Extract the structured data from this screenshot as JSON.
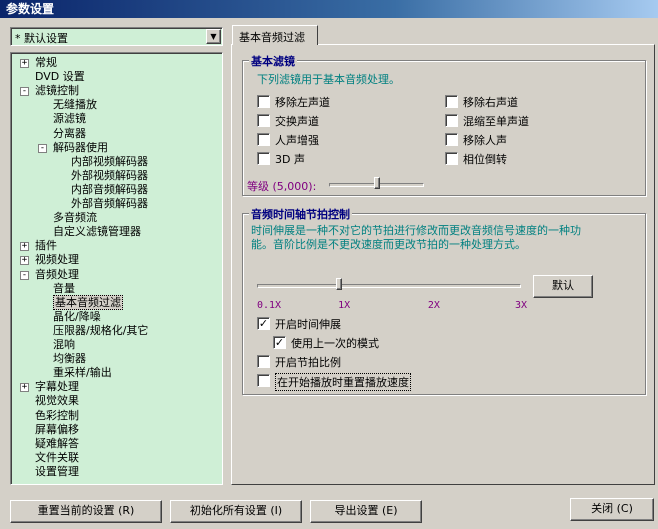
{
  "window": {
    "title": "参数设置"
  },
  "preset": {
    "value": "* 默认设置"
  },
  "tree": [
    {
      "label": "常规",
      "expander": "+"
    },
    {
      "label": "DVD 设置",
      "expander": ""
    },
    {
      "label": "滤镜控制",
      "expander": "−"
    },
    {
      "label": "无缝播放",
      "expander": ""
    },
    {
      "label": "源滤镜",
      "expander": ""
    },
    {
      "label": "分离器",
      "expander": ""
    },
    {
      "label": "解码器使用",
      "expander": "−"
    },
    {
      "label": "内部视频解码器",
      "expander": ""
    },
    {
      "label": "外部视频解码器",
      "expander": ""
    },
    {
      "label": "内部音频解码器",
      "expander": ""
    },
    {
      "label": "外部音频解码器",
      "expander": ""
    },
    {
      "label": "多音频流",
      "expander": ""
    },
    {
      "label": "自定义滤镜管理器",
      "expander": ""
    },
    {
      "label": "插件",
      "expander": "+"
    },
    {
      "label": "视频处理",
      "expander": "+"
    },
    {
      "label": "音频处理",
      "expander": "−"
    },
    {
      "label": "音量",
      "expander": ""
    },
    {
      "label": "基本音频过滤",
      "expander": ""
    },
    {
      "label": "晶化/降噪",
      "expander": ""
    },
    {
      "label": "压限器/规格化/其它",
      "expander": ""
    },
    {
      "label": "混响",
      "expander": ""
    },
    {
      "label": "均衡器",
      "expander": ""
    },
    {
      "label": "重采样/输出",
      "expander": ""
    },
    {
      "label": "字幕处理",
      "expander": "+"
    },
    {
      "label": "视觉效果",
      "expander": ""
    },
    {
      "label": "色彩控制",
      "expander": ""
    },
    {
      "label": "屏幕偏移",
      "expander": ""
    },
    {
      "label": "疑难解答",
      "expander": ""
    },
    {
      "label": "文件关联",
      "expander": ""
    },
    {
      "label": "设置管理",
      "expander": ""
    }
  ],
  "tab": {
    "label": "基本音频过滤"
  },
  "basic_filter": {
    "title": "基本滤镜",
    "description": "下列滤镜用于基本音频处理。",
    "options": [
      {
        "label": "移除左声道",
        "checked": false
      },
      {
        "label": "移除右声道",
        "checked": false
      },
      {
        "label": "交换声道",
        "checked": false
      },
      {
        "label": "混缩至单声道",
        "checked": false
      },
      {
        "label": "人声增强",
        "checked": false
      },
      {
        "label": "移除人声",
        "checked": false
      },
      {
        "label": "3D 声",
        "checked": false
      },
      {
        "label": "相位倒转",
        "checked": false
      }
    ],
    "level_label": "等级 (5,000):",
    "level_fraction": 0.5
  },
  "time_axis": {
    "title": "音频时间轴节拍控制",
    "description": "时间伸展是一种不对它的节拍进行修改而更改音频信号速度的一种功能。音阶比例是不更改速度而更改节拍的一种处理方式。",
    "default_button": "默认",
    "slider_fraction": 0.31,
    "ticks": [
      "0.1X",
      "1X",
      "2X",
      "3X"
    ],
    "options": [
      {
        "label": "开启时间伸展",
        "checked": true
      },
      {
        "label": "使用上一次的模式",
        "checked": true
      },
      {
        "label": "开启节拍比例",
        "checked": false
      },
      {
        "label": "在开始播放时重置播放速度",
        "checked": false
      }
    ]
  },
  "footer": {
    "reset": "重置当前的设置 (R)",
    "init": "初始化所有设置 (I)",
    "export": "导出设置 (E)",
    "close": "关闭 (C)"
  }
}
